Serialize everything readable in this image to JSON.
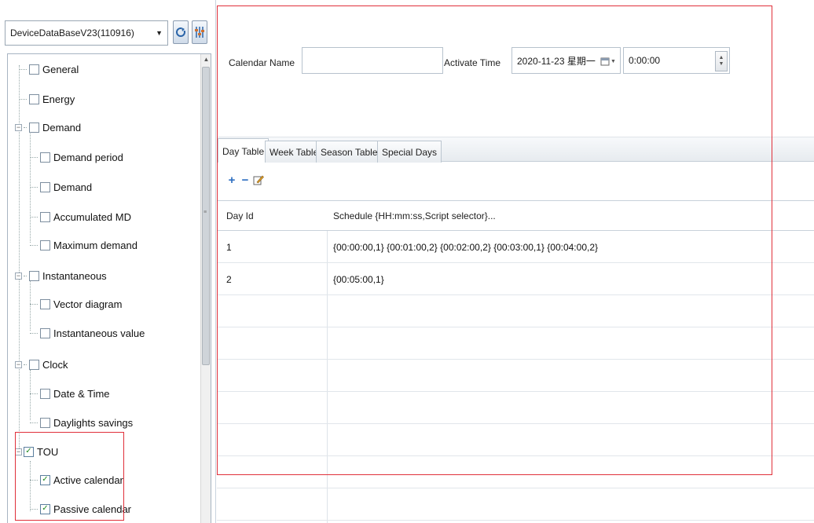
{
  "database": {
    "selected": "DeviceDataBaseV23(110916)",
    "refresh_icon": "refresh-icon",
    "settings_icon": "settings-icon"
  },
  "tree": {
    "items": [
      {
        "label": "General",
        "checked": false,
        "level": 0
      },
      {
        "label": "Energy",
        "checked": false,
        "level": 0
      },
      {
        "label": "Demand",
        "checked": false,
        "level": 0,
        "expanded": true
      },
      {
        "label": "Demand period",
        "checked": false,
        "level": 1
      },
      {
        "label": "Demand",
        "checked": false,
        "level": 1
      },
      {
        "label": "Accumulated MD",
        "checked": false,
        "level": 1
      },
      {
        "label": "Maximum demand",
        "checked": false,
        "level": 1
      },
      {
        "label": "Instantaneous",
        "checked": false,
        "level": 0,
        "expanded": true
      },
      {
        "label": "Vector diagram",
        "checked": false,
        "level": 1
      },
      {
        "label": "Instantaneous value",
        "checked": false,
        "level": 1
      },
      {
        "label": "Clock",
        "checked": false,
        "level": 0,
        "expanded": true
      },
      {
        "label": "Date & Time",
        "checked": false,
        "level": 1
      },
      {
        "label": "Daylights savings",
        "checked": false,
        "level": 1
      },
      {
        "label": "TOU",
        "checked": true,
        "level": 0,
        "expanded": true
      },
      {
        "label": "Active calendar",
        "checked": true,
        "level": 1
      },
      {
        "label": "Passive calendar",
        "checked": true,
        "level": 1
      }
    ]
  },
  "calendar": {
    "name_label": "Calendar Name",
    "name_value": "",
    "activate_label": "Activate Time",
    "date_value": "2020-11-23 星期一",
    "time_value": "0:00:00"
  },
  "tabs": [
    {
      "label": "Day Table",
      "active": true
    },
    {
      "label": "Week Table",
      "active": false
    },
    {
      "label": "Season Table",
      "active": false
    },
    {
      "label": "Special Days",
      "active": false
    }
  ],
  "toolbar": {
    "add": "+",
    "remove": "−",
    "edit_icon": "edit-icon"
  },
  "grid": {
    "columns": [
      "Day Id",
      "Schedule {HH:mm:ss,Script selector}..."
    ],
    "rows": [
      {
        "day_id": "1",
        "schedule": "{00:00:00,1} {00:01:00,2} {00:02:00,2} {00:03:00,1} {00:04:00,2}"
      },
      {
        "day_id": "2",
        "schedule": "{00:05:00,1}"
      }
    ]
  },
  "colors": {
    "highlight": "#e0303a",
    "check": "#1f8a1f",
    "accent": "#2a64a8"
  }
}
